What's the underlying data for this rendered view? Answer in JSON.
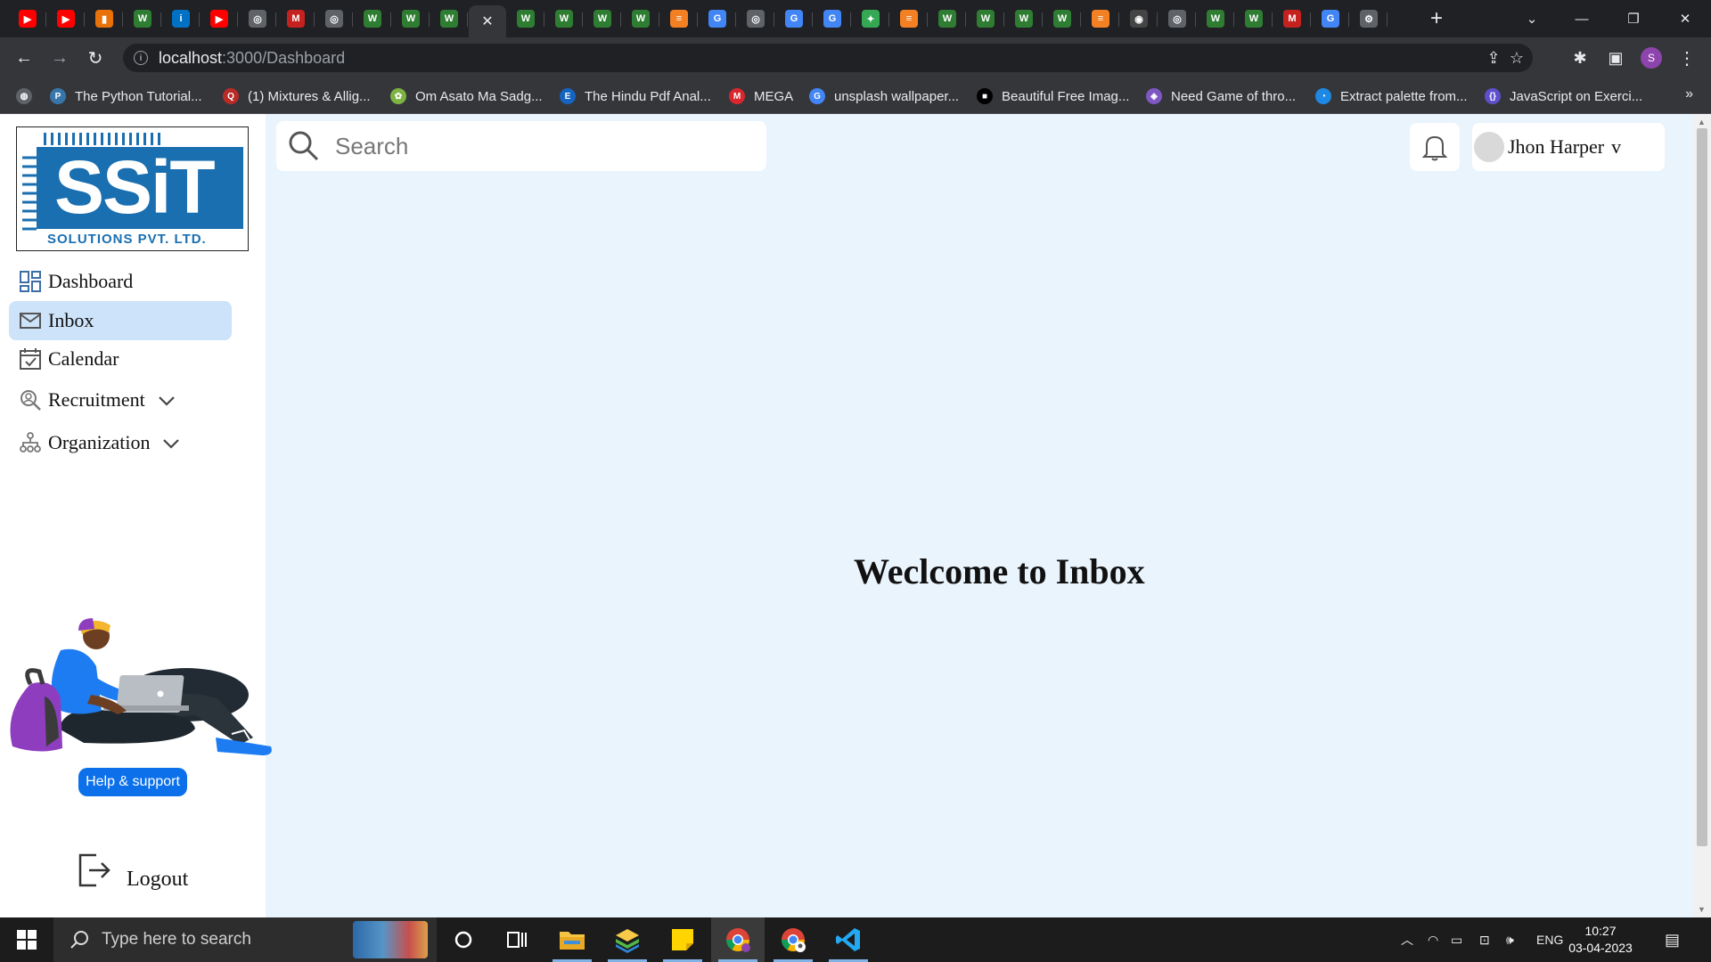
{
  "browser": {
    "tabs": [
      {
        "icon": "youtube-icon",
        "color": "#ff0000",
        "glyph": "▶"
      },
      {
        "icon": "youtube-icon",
        "color": "#ff0000",
        "glyph": "▶"
      },
      {
        "icon": "bar-chart-icon",
        "color": "#e8710a",
        "glyph": "▮"
      },
      {
        "icon": "w-icon",
        "color": "#2e7d32",
        "glyph": "W"
      },
      {
        "icon": "intel-icon",
        "color": "#0071c5",
        "glyph": "i"
      },
      {
        "icon": "youtube-icon",
        "color": "#ff0000",
        "glyph": "▶"
      },
      {
        "icon": "chrome-icon",
        "color": "#5f6368",
        "glyph": "◎"
      },
      {
        "icon": "gmail-icon",
        "color": "#c5221f",
        "glyph": "M"
      },
      {
        "icon": "chrome-icon",
        "color": "#5f6368",
        "glyph": "◎"
      },
      {
        "icon": "w-icon",
        "color": "#2e7d32",
        "glyph": "W"
      },
      {
        "icon": "w-icon",
        "color": "#2e7d32",
        "glyph": "W"
      },
      {
        "icon": "w-icon",
        "color": "#2e7d32",
        "glyph": "W"
      },
      {
        "icon": "close-tab-icon",
        "active": true
      },
      {
        "icon": "w-icon",
        "color": "#2e7d32",
        "glyph": "W"
      },
      {
        "icon": "w-icon",
        "color": "#2e7d32",
        "glyph": "W"
      },
      {
        "icon": "w-icon",
        "color": "#2e7d32",
        "glyph": "W"
      },
      {
        "icon": "w-icon",
        "color": "#2e7d32",
        "glyph": "W"
      },
      {
        "icon": "stack-icon",
        "color": "#f48024",
        "glyph": "≡"
      },
      {
        "icon": "google-icon",
        "color": "#4285f4",
        "glyph": "G"
      },
      {
        "icon": "chrome-icon",
        "color": "#5f6368",
        "glyph": "◎"
      },
      {
        "icon": "google-icon",
        "color": "#4285f4",
        "glyph": "G"
      },
      {
        "icon": "google-icon",
        "color": "#4285f4",
        "glyph": "G"
      },
      {
        "icon": "bulb-icon",
        "color": "#34a853",
        "glyph": "✦"
      },
      {
        "icon": "stack-icon",
        "color": "#f48024",
        "glyph": "≡"
      },
      {
        "icon": "w-icon",
        "color": "#2e7d32",
        "glyph": "W"
      },
      {
        "icon": "w-icon",
        "color": "#2e7d32",
        "glyph": "W"
      },
      {
        "icon": "w-icon",
        "color": "#2e7d32",
        "glyph": "W"
      },
      {
        "icon": "w-icon",
        "color": "#2e7d32",
        "glyph": "W"
      },
      {
        "icon": "stack-icon",
        "color": "#f48024",
        "glyph": "≡"
      },
      {
        "icon": "github-icon",
        "color": "#444",
        "glyph": "◉"
      },
      {
        "icon": "chrome-icon",
        "color": "#5f6368",
        "glyph": "◎"
      },
      {
        "icon": "w-icon",
        "color": "#2e7d32",
        "glyph": "W"
      },
      {
        "icon": "w-icon",
        "color": "#2e7d32",
        "glyph": "W"
      },
      {
        "icon": "gmail-icon",
        "color": "#c5221f",
        "glyph": "M"
      },
      {
        "icon": "google-icon",
        "color": "#4285f4",
        "glyph": "G"
      },
      {
        "icon": "settings-icon",
        "color": "#5f6368",
        "glyph": "⚙"
      }
    ],
    "url_host": "localhost",
    "url_path": ":3000/Dashboard",
    "profile_initial": "S",
    "bookmarks": [
      {
        "label": "The Python Tutorial...",
        "icon": "python-icon",
        "color": "#3776ab",
        "glyph": "P"
      },
      {
        "label": "(1) Mixtures & Allig...",
        "icon": "quora-icon",
        "color": "#b92b27",
        "glyph": "Q"
      },
      {
        "label": "Om Asato Ma Sadg...",
        "icon": "image-icon",
        "color": "#7cb342",
        "glyph": "✿"
      },
      {
        "label": "The Hindu Pdf Anal...",
        "icon": "e-icon",
        "color": "#1565c0",
        "glyph": "E"
      },
      {
        "label": "MEGA",
        "icon": "mega-icon",
        "color": "#d9272e",
        "glyph": "M"
      },
      {
        "label": "unsplash wallpaper...",
        "icon": "google-icon",
        "color": "#4285f4",
        "glyph": "G"
      },
      {
        "label": "Beautiful Free Imag...",
        "icon": "unsplash-icon",
        "color": "#000000",
        "glyph": "■"
      },
      {
        "label": "Need Game of thro...",
        "icon": "game-icon",
        "color": "#7e57c2",
        "glyph": "◈"
      },
      {
        "label": "Extract palette from...",
        "icon": "palette-icon",
        "color": "#1e88e5",
        "glyph": "◔"
      },
      {
        "label": "JavaScript on Exerci...",
        "icon": "exercism-icon",
        "color": "#604fcd",
        "glyph": "{}"
      }
    ]
  },
  "page": {
    "logo": {
      "top": "SSiT",
      "bottom": "SOLUTIONS PVT. LTD."
    },
    "nav": [
      {
        "label": "Dashboard",
        "icon": "dashboard-icon",
        "active": false
      },
      {
        "label": "Inbox",
        "icon": "mail-icon",
        "active": true
      },
      {
        "label": "Calendar",
        "icon": "calendar-icon",
        "active": false
      },
      {
        "label": "Recruitment",
        "icon": "recruitment-icon",
        "active": false,
        "expandable": true
      },
      {
        "label": "Organization",
        "icon": "organization-icon",
        "active": false,
        "expandable": true
      }
    ],
    "help_label": "Help & support",
    "logout_label": "Logout",
    "search_placeholder": "Search",
    "user_name": "Jhon Harper",
    "user_caret": "v",
    "welcome_text": "Weclcome to Inbox",
    "accent": "#0b70ea",
    "active_bg": "#cde3fa",
    "page_bg": "#eaf4fd"
  },
  "taskbar": {
    "search_placeholder": "Type here to search",
    "language": "ENG",
    "time": "10:27",
    "date": "03-04-2023"
  }
}
